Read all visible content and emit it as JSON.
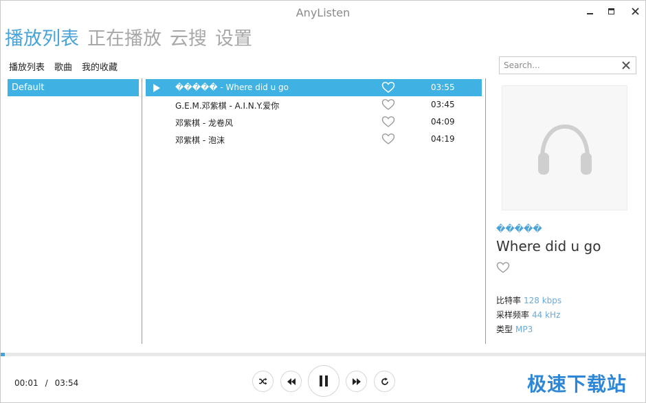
{
  "window": {
    "title": "AnyListen"
  },
  "main_nav": {
    "tabs": [
      {
        "label": "播放列表",
        "active": true
      },
      {
        "label": "正在播放",
        "active": false
      },
      {
        "label": "云搜",
        "active": false
      },
      {
        "label": "设置",
        "active": false
      }
    ]
  },
  "sub_nav": {
    "tabs": [
      {
        "label": "播放列表"
      },
      {
        "label": "歌曲"
      },
      {
        "label": "我的收藏"
      }
    ]
  },
  "search": {
    "placeholder": "Search...",
    "value": ""
  },
  "playlists": [
    {
      "name": "Default",
      "selected": true
    }
  ],
  "songs": [
    {
      "title": "����� - Where did u go",
      "duration": "03:55",
      "playing": true
    },
    {
      "title": "G.E.M.邓紫棋 - A.I.N.Y.爱你",
      "duration": "03:45",
      "playing": false
    },
    {
      "title": "邓紫棋 - 龙卷风",
      "duration": "04:09",
      "playing": false
    },
    {
      "title": "邓紫棋 - 泡沫",
      "duration": "04:19",
      "playing": false
    }
  ],
  "now_playing": {
    "artist": "�����",
    "title": "Where did u go",
    "bitrate_label": "比特率",
    "bitrate": "128 kbps",
    "sample_label": "采样频率",
    "sample": "44 kHz",
    "type_label": "类型",
    "type": "MP3"
  },
  "playback": {
    "current_time": "00:01",
    "separator": "/",
    "total_time": "03:54",
    "progress_fraction": 0.005
  },
  "controls": {
    "shuffle_icon": "shuffle-icon",
    "prev_icon": "rewind-icon",
    "pause_icon": "pause-icon",
    "next_icon": "fast-forward-icon",
    "repeat_icon": "repeat-icon"
  },
  "watermark": {
    "text": "极速下载站"
  },
  "colors": {
    "accent": "#3fb1e3",
    "accent_text": "#4aa3d8",
    "inactive_tab": "#a8a8a8"
  }
}
